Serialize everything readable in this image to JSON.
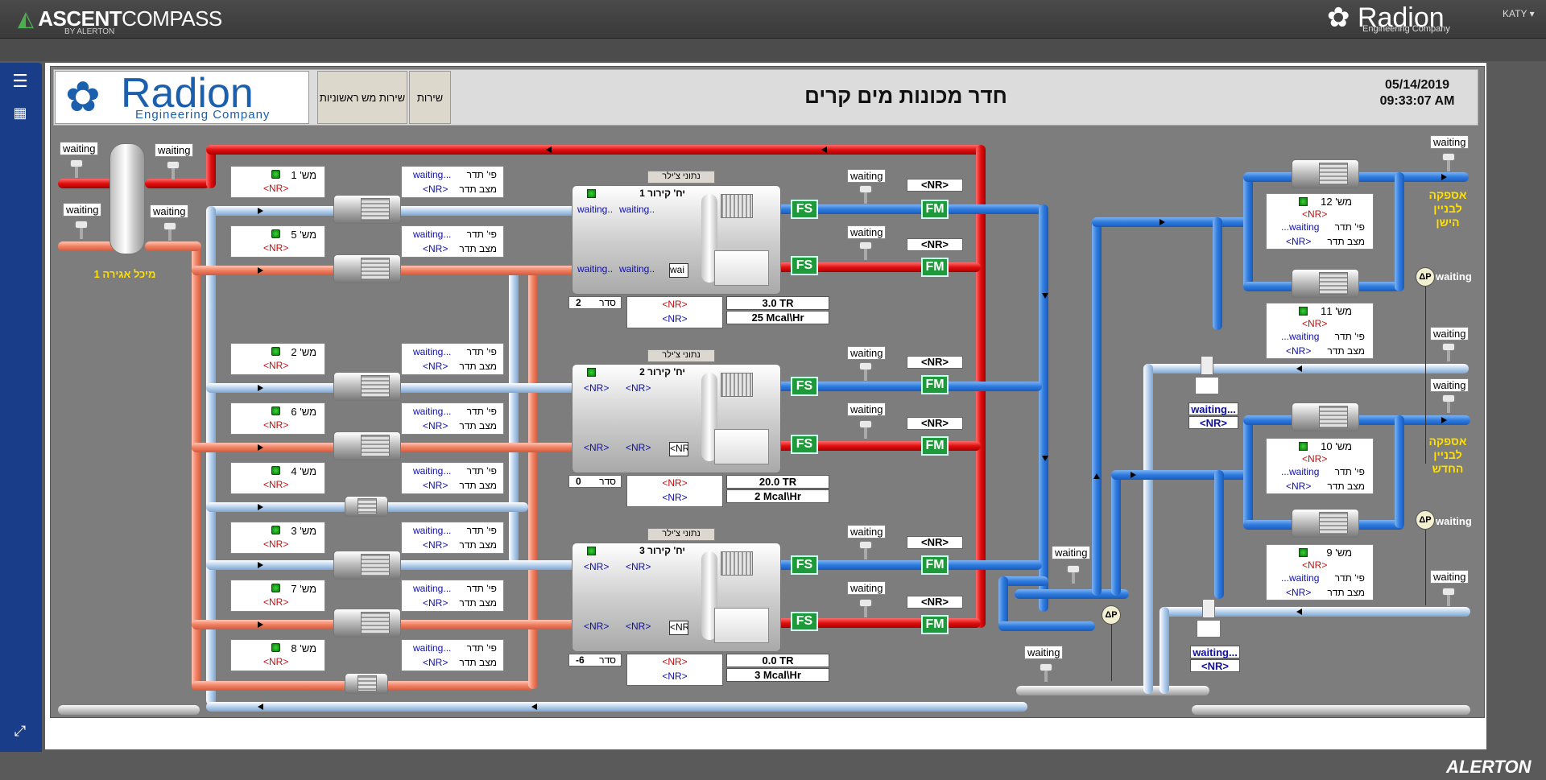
{
  "app": {
    "brand": "ASCENT",
    "brand_lite": "COMPASS",
    "brand_sub": "BY ALERTON",
    "top_logo": "Radion",
    "top_logo_sub": "Engineering Company",
    "user": "KATY ▾",
    "footer_brand": "ALERTON"
  },
  "nav": {
    "menu_icon": "☰",
    "grid_icon": "▦",
    "expand_icon": "⤢"
  },
  "header": {
    "logo_word": "Radion",
    "logo_sub": "Engineering Company",
    "tab_primary": "שירות מש ראשוניות",
    "tab_service": "שירות",
    "title": "חדר מכונות מים קרים",
    "date": "05/14/2019",
    "time": "09:33:07 AM"
  },
  "tank": {
    "label": "מיכל אגירה 1"
  },
  "waiting": "waiting",
  "nr": "<NR>",
  "pumps": [
    {
      "name": "מש' 1",
      "nr": "<NR>"
    },
    {
      "name": "מש' 5",
      "nr": "<NR>"
    },
    {
      "name": "מש' 2",
      "nr": "<NR>"
    },
    {
      "name": "מש' 6",
      "nr": "<NR>"
    },
    {
      "name": "מש' 4",
      "nr": "<NR>"
    },
    {
      "name": "מש' 3",
      "nr": "<NR>"
    },
    {
      "name": "מש' 7",
      "nr": "<NR>"
    },
    {
      "name": "מש' 8",
      "nr": "<NR>"
    }
  ],
  "vfd": {
    "waiting": "waiting...",
    "nr": "<NR>",
    "label1": "פי' תדר",
    "label2": "מצב תדר"
  },
  "chillers": [
    {
      "tag": "נתוני צ'ילר",
      "title": "יח' קירור 1",
      "t1": "waiting..",
      "t2": "waiting..",
      "t3": "waiting..",
      "t4": "waiting..",
      "box": "wai",
      "seq_val": "2",
      "seq_label": "סדר",
      "nr1": "<NR>",
      "nr2": "<NR>",
      "cap1": "3.0 TR",
      "cap2": "25 Mcal\\Hr"
    },
    {
      "tag": "נתוני צ'ילר",
      "title": "יח' קירור 2",
      "t1": "<NR>",
      "t2": "<NR>",
      "t3": "<NR>",
      "t4": "<NR>",
      "box": "<NR>",
      "seq_val": "0",
      "seq_label": "סדר",
      "nr1": "<NR>",
      "nr2": "<NR>",
      "cap1": "20.0 TR",
      "cap2": "2 Mcal\\Hr"
    },
    {
      "tag": "נתוני צ'ילר",
      "title": "יח' קירור 3",
      "t1": "<NR>",
      "t2": "<NR>",
      "t3": "<NR>",
      "t4": "<NR>",
      "box": "<NR>",
      "seq_val": "-6",
      "seq_label": "סדר",
      "nr1": "<NR>",
      "nr2": "<NR>",
      "cap1": "0.0 TR",
      "cap2": "3 Mcal\\Hr"
    }
  ],
  "fs": "FS",
  "fm": "FM",
  "dp": "ΔP",
  "supply_old": "אספקה לבניין הישן",
  "supply_new": "אספקה לבניין החדש",
  "big_pumps": [
    {
      "name": "מש' 12",
      "nr": "<NR>",
      "l1": "פי' תדר",
      "w": "waiting...",
      "l2": "מצב תדר",
      "nr2": "<NR>"
    },
    {
      "name": "מש' 11",
      "nr": "<NR>",
      "l1": "פי' תדר",
      "w": "waiting...",
      "l2": "מצב תדר",
      "nr2": "<NR>"
    },
    {
      "name": "מש' 10",
      "nr": "<NR>",
      "l1": "פי' תדר",
      "w": "waiting...",
      "l2": "מצב תדר",
      "nr2": "<NR>"
    },
    {
      "name": "מש' 9",
      "nr": "<NR>",
      "l1": "פי' תדר",
      "w": "waiting...",
      "l2": "מצב תדר",
      "nr2": "<NR>"
    }
  ],
  "control_valves": [
    {
      "w": "waiting...",
      "nr": "<NR>"
    },
    {
      "w": "waiting...",
      "nr": "<NR>"
    }
  ]
}
